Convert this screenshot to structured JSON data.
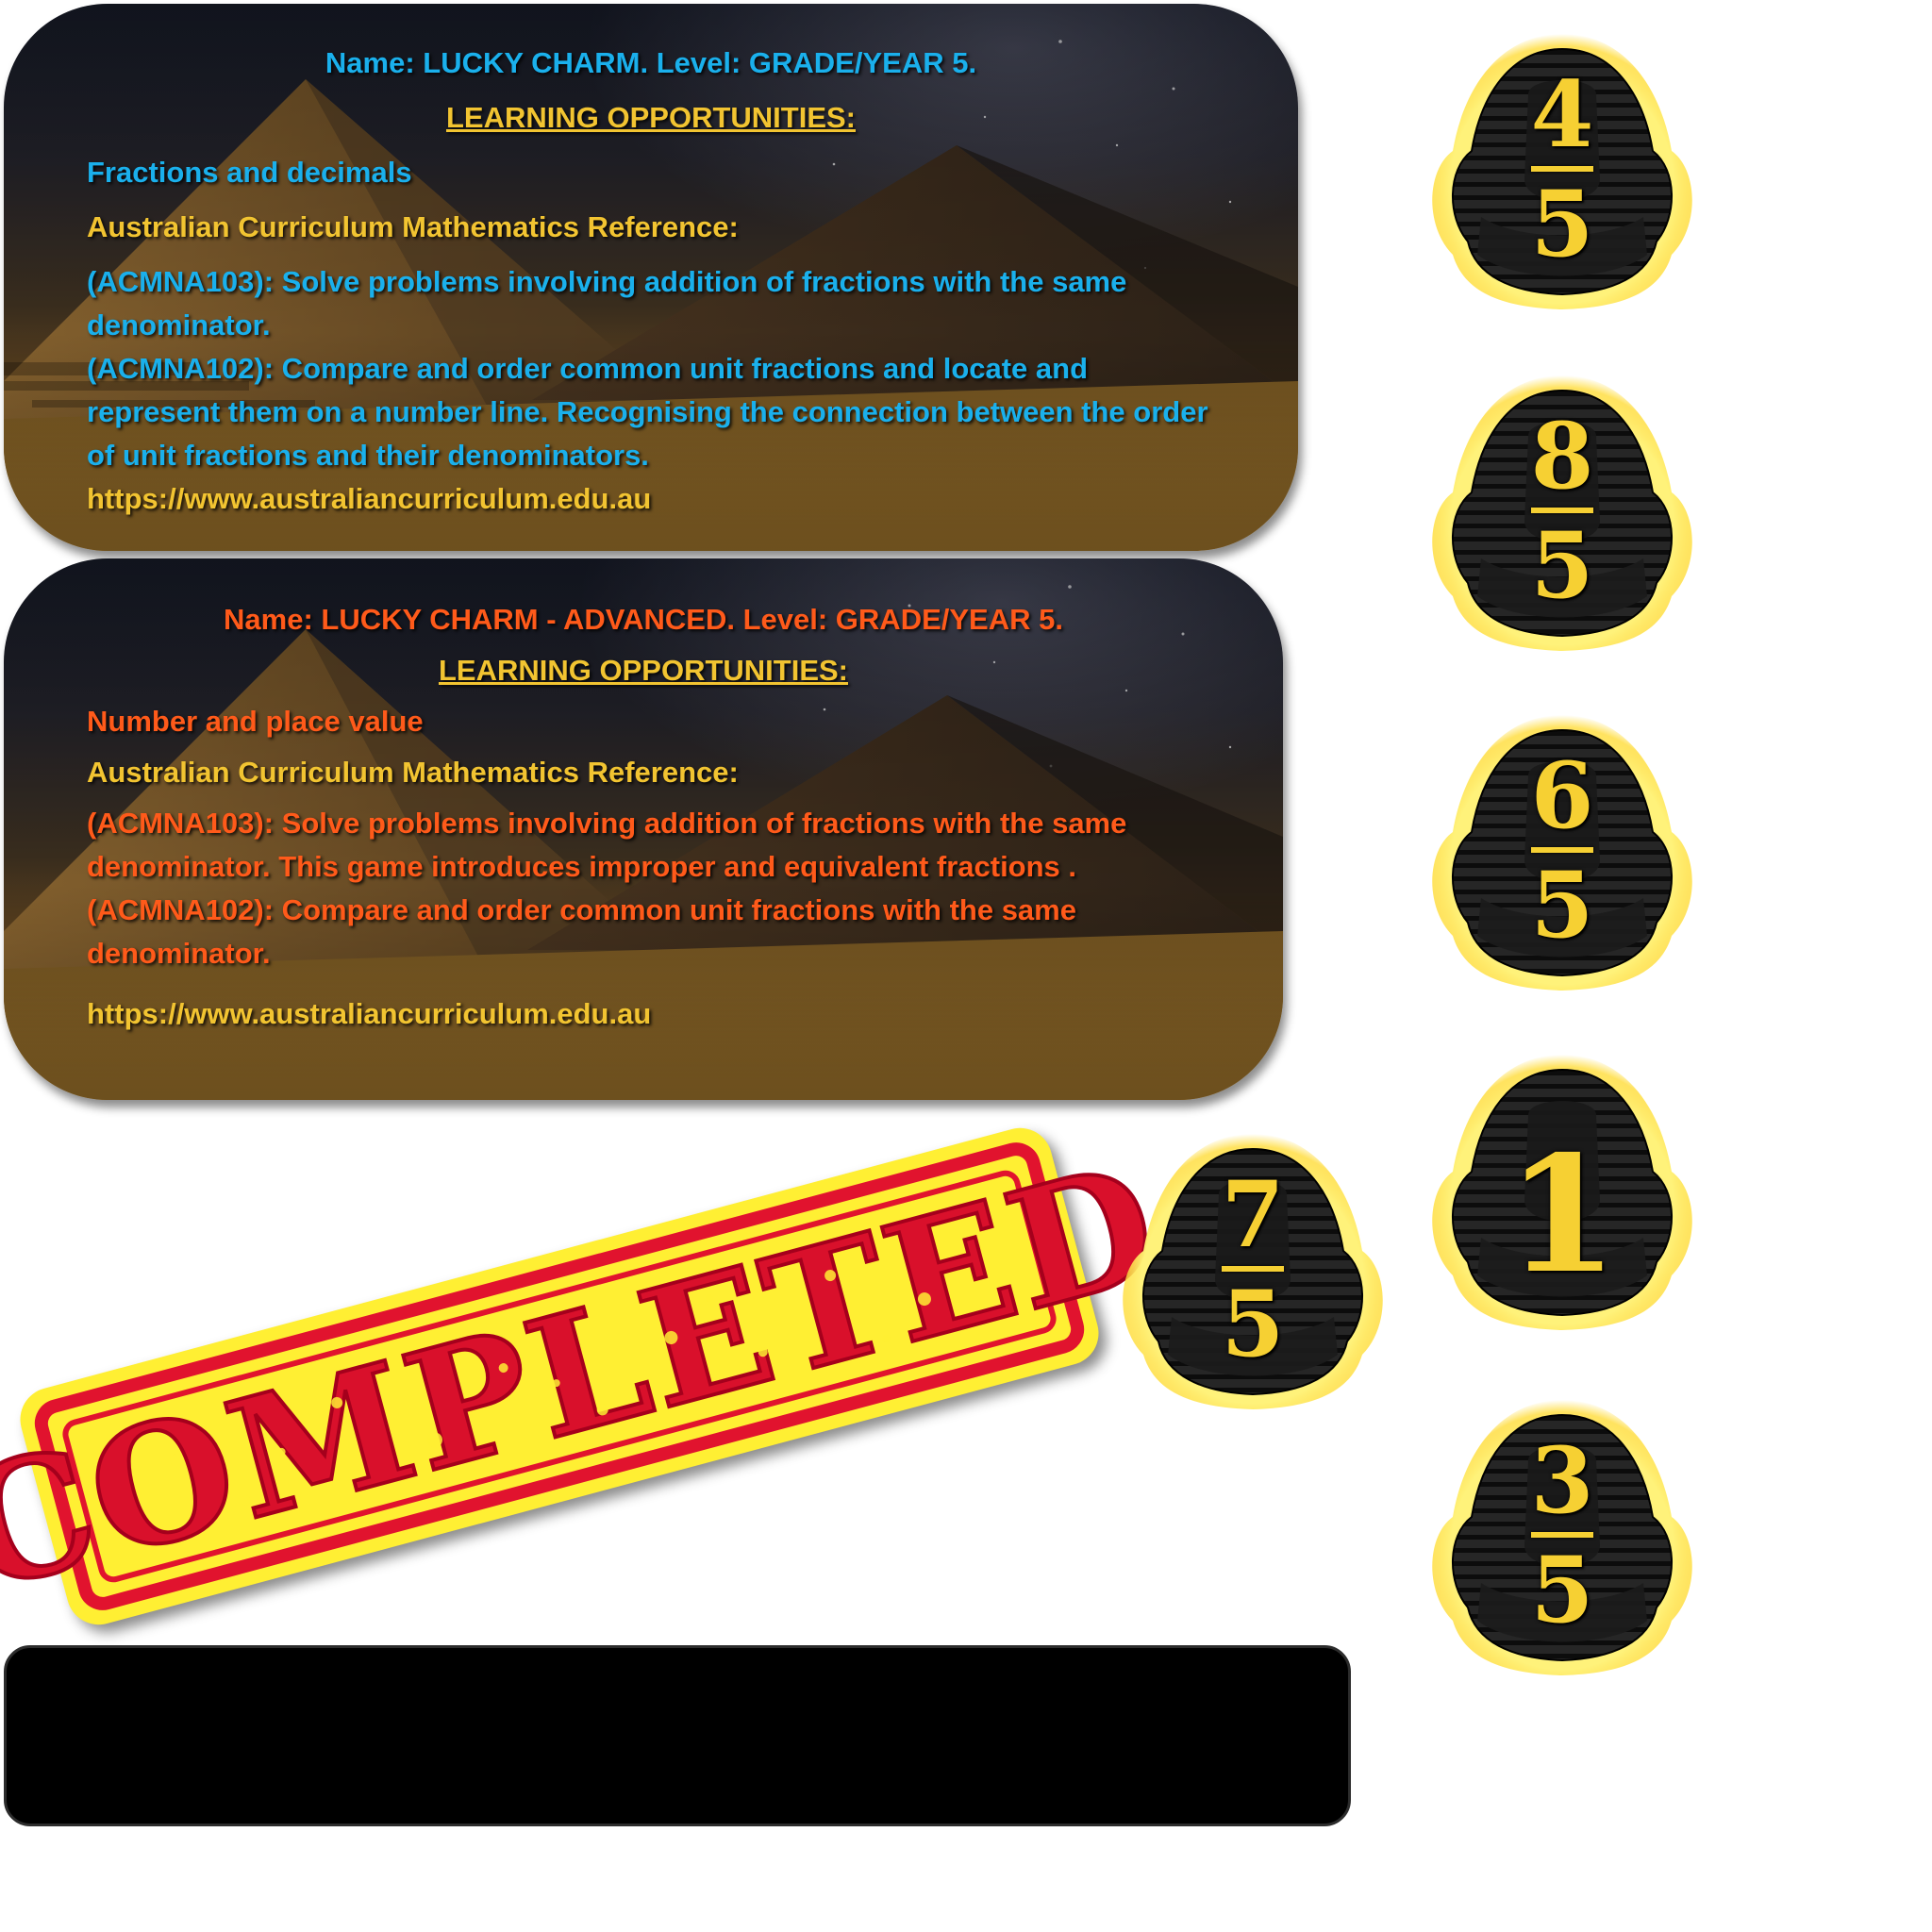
{
  "panels": [
    {
      "title": "Name: LUCKY CHARM. Level: GRADE/YEAR 5.",
      "heading": "LEARNING OPPORTUNITIES:",
      "topic": "Fractions and decimals",
      "reference_label": "Australian Curriculum Mathematics Reference:",
      "paragraph": "(ACMNA103): Solve problems involving addition of fractions with the same denominator.\n(ACMNA102): Compare and order common unit fractions and locate and represent them on a number line. Recognising the connection between the order of unit fractions and their denominators.",
      "link": "https://www.australiancurriculum.edu.au",
      "accent_color": "#1ab0ec"
    },
    {
      "title": "Name: LUCKY CHARM - ADVANCED. Level: GRADE/YEAR 5.",
      "heading": "LEARNING OPPORTUNITIES:",
      "topic": "Number and place value",
      "reference_label": "Australian Curriculum Mathematics Reference:",
      "paragraph": "(ACMNA103): Solve problems involving addition of fractions with the same denominator. This game introduces improper and equivalent fractions .\n(ACMNA102): Compare and order common unit fractions with the same denominator.",
      "link": "https://www.australiancurriculum.edu.au",
      "accent_color": "#ff5a1a"
    }
  ],
  "stamp": {
    "text": "COMPLETED",
    "colors": {
      "fill": "#ffef33",
      "ink": "#e1132e"
    }
  },
  "tokens": [
    {
      "numerator": "4",
      "denominator": "5",
      "icon": "pharaoh-mask-icon"
    },
    {
      "numerator": "8",
      "denominator": "5",
      "icon": "pharaoh-mask-icon"
    },
    {
      "numerator": "6",
      "denominator": "5",
      "icon": "pharaoh-mask-icon"
    },
    {
      "whole": "1",
      "icon": "pharaoh-mask-icon"
    },
    {
      "numerator": "3",
      "denominator": "5",
      "icon": "pharaoh-mask-icon"
    },
    {
      "numerator": "7",
      "denominator": "5",
      "icon": "pharaoh-mask-icon"
    }
  ],
  "colors": {
    "gold": "#f2c431",
    "token_number": "#f6d033",
    "token_glow": "#ffe34a",
    "bar_bg": "#000000"
  }
}
